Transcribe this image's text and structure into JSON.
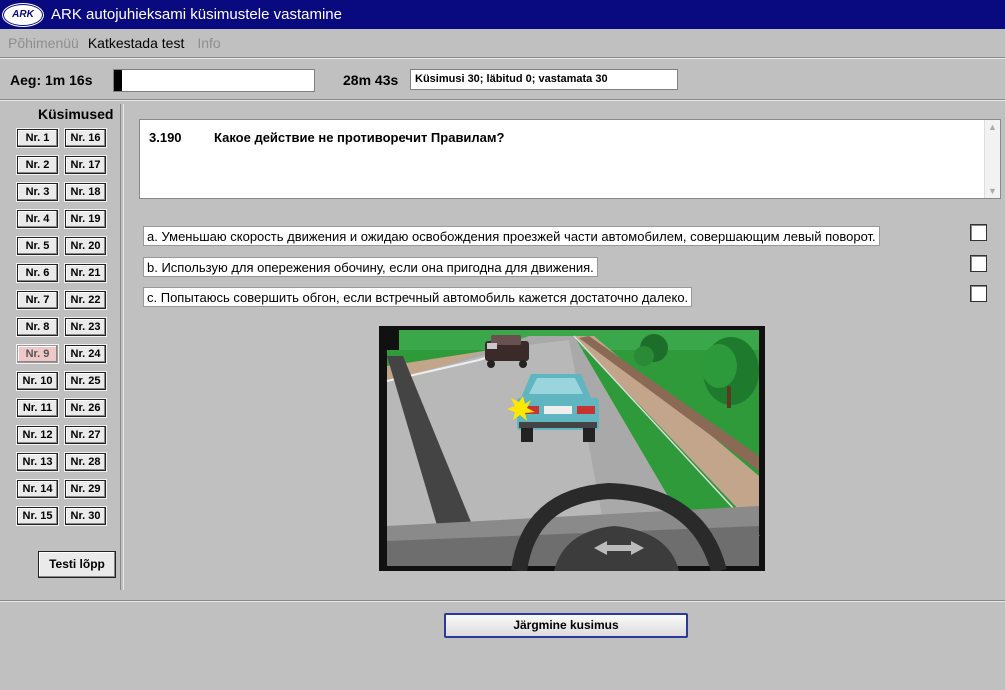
{
  "window": {
    "logo": "ARK",
    "title": "ARK autojuhieksami küsimustele vastamine"
  },
  "menu": [
    {
      "label": "Põhimenüü",
      "enabled": false
    },
    {
      "label": "Katkestada test",
      "enabled": true
    },
    {
      "label": "Info",
      "enabled": false
    }
  ],
  "timer": {
    "elapsed": "Aeg: 1m 16s",
    "remaining": "28m 43s",
    "progress_fraction": 0.04
  },
  "status": "Küsimusi 30; läbitud 0; vastamata 30",
  "sidebar": {
    "title": "Küsimused",
    "questions_left": [
      "Nr. 1",
      "Nr. 2",
      "Nr. 3",
      "Nr. 4",
      "Nr. 5",
      "Nr. 6",
      "Nr. 7",
      "Nr. 8",
      "Nr. 9",
      "Nr. 10",
      "Nr. 11",
      "Nr. 12",
      "Nr. 13",
      "Nr. 14",
      "Nr. 15"
    ],
    "questions_right": [
      "Nr. 16",
      "Nr. 17",
      "Nr. 18",
      "Nr. 19",
      "Nr. 20",
      "Nr. 21",
      "Nr. 22",
      "Nr. 23",
      "Nr. 24",
      "Nr. 25",
      "Nr. 26",
      "Nr. 27",
      "Nr. 28",
      "Nr. 29",
      "Nr. 30"
    ],
    "current": "Nr. 9",
    "end_label": "Testi lõpp"
  },
  "question": {
    "number": "3.190",
    "text": "Какое действие не противоречит Правилам?",
    "answers": [
      {
        "text": "a. Уменьшаю скорость движения и ожидаю освобождения проезжей части автомобилем, совершающим левый поворот.",
        "checked": false
      },
      {
        "text": "b. Использую для опережения обочину, если она пригодна для движения.",
        "checked": false
      },
      {
        "text": "c. Попытаюсь совершить обгон, если встречный автомобиль кажется достаточно далеко.",
        "checked": false
      }
    ]
  },
  "next_label": "Järgmine kusimus",
  "colors": {
    "title_bar": "#0a0a80",
    "background": "#c0c0c0",
    "current_question": "#f0c8c8",
    "car": "#5fb5c0"
  }
}
